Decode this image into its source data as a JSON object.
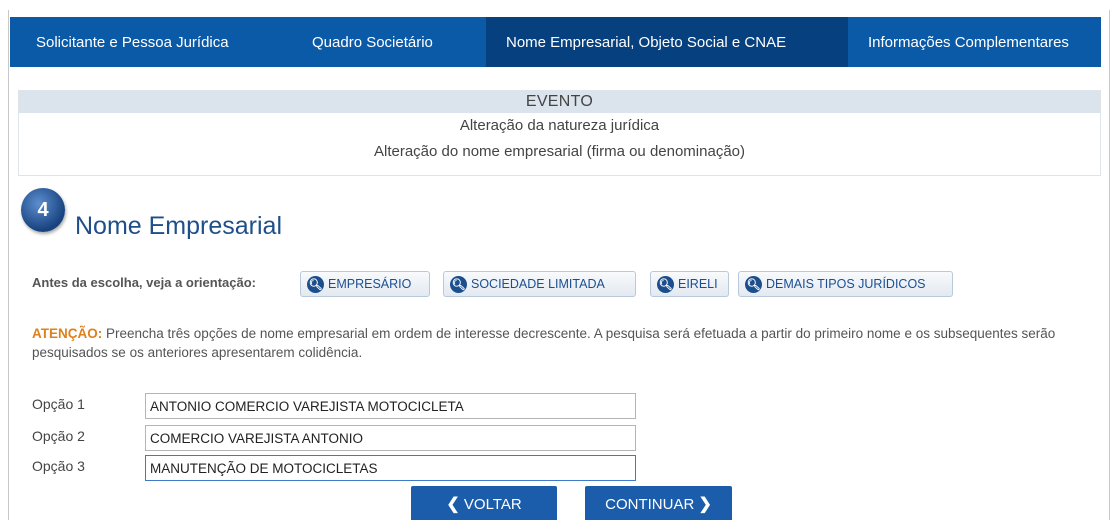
{
  "tabs": [
    {
      "label": "Solicitante e Pessoa Jurídica"
    },
    {
      "label": "Quadro Societário"
    },
    {
      "label": "Nome Empresarial, Objeto Social e CNAE"
    },
    {
      "label": "Informações Complementares"
    }
  ],
  "evento": {
    "header": "EVENTO",
    "items": [
      "Alteração da natureza jurídica",
      "Alteração do nome empresarial (firma ou denominação)"
    ]
  },
  "section": {
    "step_number": "4",
    "title": "Nome Empresarial"
  },
  "orientation": {
    "label": "Antes da escolha, veja a orientação:",
    "buttons": [
      {
        "label": "EMPRESÁRIO",
        "icon": "search-icon"
      },
      {
        "label": "SOCIEDADE LIMITADA",
        "icon": "search-icon"
      },
      {
        "label": "EIRELI",
        "icon": "search-icon"
      },
      {
        "label": "DEMAIS TIPOS JURÍDICOS",
        "icon": "search-icon"
      }
    ]
  },
  "attention": {
    "label": "ATENÇÃO:",
    "text": " Preencha três opções de nome empresarial em ordem de interesse decrescente. A pesquisa será efetuada a partir do primeiro nome e os subsequentes serão pesquisados se os anteriores apresentarem colidência."
  },
  "options": [
    {
      "label": "Opção 1",
      "value": "ANTONIO COMERCIO VAREJISTA MOTOCICLETA"
    },
    {
      "label": "Opção 2",
      "value": "COMERCIO VAREJISTA ANTONIO"
    },
    {
      "label": "Opção 3",
      "value": "MANUTENÇÃO DE MOTOCICLETAS"
    }
  ],
  "nav": {
    "back_label": "VOLTAR",
    "next_label": "CONTINUAR"
  },
  "colors": {
    "tab_bar": "#0a5aa8",
    "tab_active": "#06407e",
    "title": "#1f4f8a",
    "attention": "#e0801a",
    "nav_button": "#1b5cab"
  }
}
